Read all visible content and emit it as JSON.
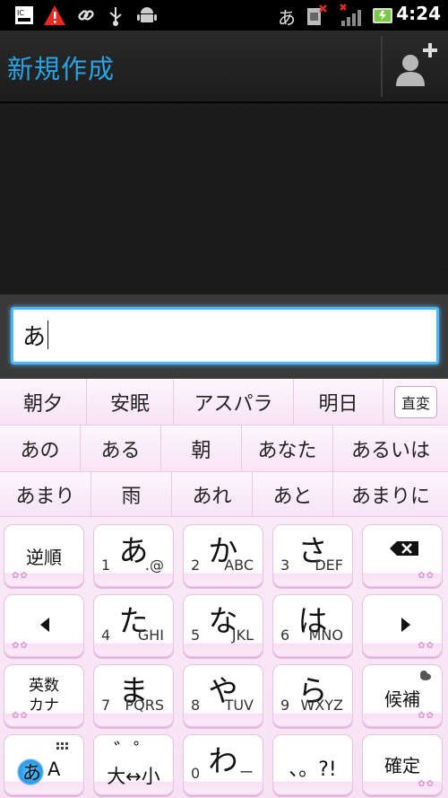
{
  "status_bar": {
    "ime_char": "あ",
    "clock": "4:24",
    "icons": [
      "ic-card-icon",
      "warning-icon",
      "link-icon",
      "usb-icon",
      "android-debug-icon",
      "sim-error-icon",
      "no-signal-icon",
      "battery-icon"
    ]
  },
  "title_bar": {
    "title": "新規作成",
    "add_contact_icon": "add-contact-icon"
  },
  "compose": {
    "text": "あ"
  },
  "candidates": {
    "row1": [
      "朝夕",
      "安眠",
      "アスパラ",
      "明日"
    ],
    "henkan": "直変",
    "row2": [
      "あの",
      "ある",
      "朝",
      "あなた",
      "あるいは"
    ],
    "row3": [
      "あまり",
      "雨",
      "あれ",
      "あと",
      "あまりに"
    ]
  },
  "keys": {
    "reverse": "逆順",
    "a": {
      "kana": "あ",
      "num": "1",
      "sub": ".@"
    },
    "ka": {
      "kana": "か",
      "num": "2",
      "sub": "ABC"
    },
    "sa": {
      "kana": "さ",
      "num": "3",
      "sub": "DEF"
    },
    "ta": {
      "kana": "た",
      "num": "4",
      "sub": "GHI"
    },
    "na": {
      "kana": "な",
      "num": "5",
      "sub": "JKL"
    },
    "ha": {
      "kana": "は",
      "num": "6",
      "sub": "MNO"
    },
    "ma": {
      "kana": "ま",
      "num": "7",
      "sub": "PQRS"
    },
    "ya": {
      "kana": "や",
      "num": "8",
      "sub": "TUV"
    },
    "ra": {
      "kana": "ら",
      "num": "9",
      "sub": "WXYZ"
    },
    "wa": {
      "kana": "わ",
      "num": "0",
      "sub": "ー"
    },
    "eisu_line1": "英数",
    "eisu_line2": "カナ",
    "candidate": "候補",
    "mode_a": "あ",
    "mode_b": "A",
    "dakuten_top": "゛゜",
    "dakuten_bottom": "大↔小",
    "punct": "、。?!",
    "confirm": "確定"
  },
  "colors": {
    "title": "#2aa3e6",
    "focus": "#4db6ff",
    "keyboard_bg": "#f8e6f6"
  }
}
